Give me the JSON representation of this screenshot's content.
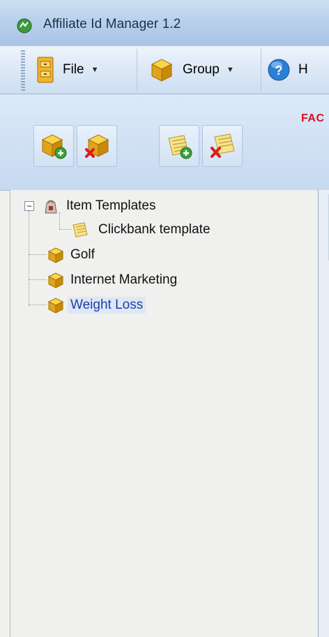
{
  "window": {
    "title": "Affiliate Id Manager 1.2"
  },
  "menubar": {
    "items": [
      {
        "label": "File",
        "icon": "file-cabinet-icon"
      },
      {
        "label": "Group",
        "icon": "group-box-icon"
      },
      {
        "label": "H",
        "icon": "help-icon"
      }
    ]
  },
  "ribbon": {
    "faq_label": "FAC",
    "buttons": [
      {
        "name": "add-group-button",
        "icon": "add-group-icon"
      },
      {
        "name": "delete-group-button",
        "icon": "delete-group-icon"
      },
      {
        "name": "add-item-button",
        "icon": "add-item-icon"
      },
      {
        "name": "delete-item-button",
        "icon": "delete-item-icon"
      }
    ]
  },
  "tree": {
    "root": {
      "label": "Item Templates",
      "expander": "−"
    },
    "children": [
      {
        "label": "Clickbank template"
      }
    ],
    "groups": [
      {
        "label": "Golf"
      },
      {
        "label": "Internet Marketing"
      },
      {
        "label": "Weight Loss",
        "selected": true
      }
    ]
  },
  "colors": {
    "accent_text": "#2040a8",
    "faq_red": "#d4121e",
    "box_gold": "#e7b21a"
  }
}
